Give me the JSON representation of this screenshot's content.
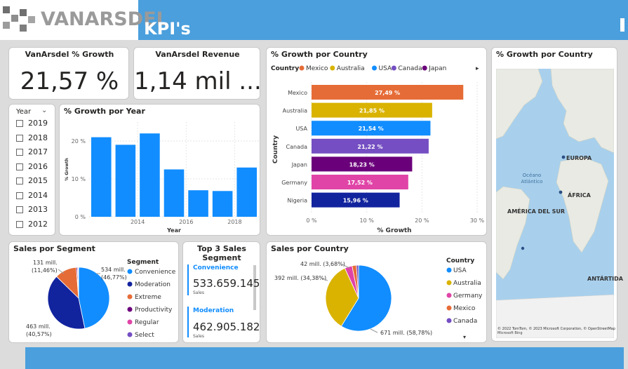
{
  "header": {
    "logo_text": "VANARSDEL",
    "page_title": "KPI's"
  },
  "kpis": {
    "growth": {
      "title": "VanArsdel % Growth",
      "value": "21,57 %"
    },
    "revenue": {
      "title": "VanArsdel Revenue",
      "value": "1,14 mil ..."
    }
  },
  "slicer": {
    "title": "Year",
    "years": [
      "2019",
      "2018",
      "2017",
      "2016",
      "2015",
      "2014",
      "2013",
      "2012"
    ]
  },
  "growth_by_year": {
    "title": "% Growth por Year"
  },
  "growth_by_country": {
    "title": "% Growth por Country",
    "legend_title": "Country"
  },
  "map": {
    "title": "% Growth por Country",
    "labels": {
      "europe": "EUROPA",
      "ocean": "Océano Atlántico",
      "africa": "ÁFRICA",
      "south_america": "AMÉRICA DEL SUR",
      "antarctica": "ANTÁRTIDA"
    },
    "attribution": "© 2022 TomTom, © 2023 Microsoft Corporation, © OpenStreetMap",
    "bing": "Microsoft Bing"
  },
  "sales_segment": {
    "title": "Sales por Segment",
    "legend_title": "Segment"
  },
  "top3": {
    "title": "Top 3 Sales Segment",
    "items": [
      {
        "label": "Convenience",
        "value": "533.659.145",
        "sub": "Sales"
      },
      {
        "label": "Moderation",
        "value": "462.905.182",
        "sub": "Sales"
      }
    ]
  },
  "sales_country": {
    "title": "Sales por Country",
    "legend_title": "Country"
  },
  "colors": {
    "header_blue": "#4a9fdc",
    "bar_blue": "#118dff",
    "navy": "#12239e",
    "orange": "#e66c37"
  },
  "chart_data": [
    {
      "type": "bar",
      "title": "% Growth por Year",
      "xlabel": "Year",
      "ylabel": "% Growth",
      "x": [
        2013,
        2014,
        2015,
        2016,
        2017,
        2018,
        2019
      ],
      "values": [
        21.0,
        19.0,
        22.0,
        12.5,
        7.0,
        6.8,
        13.0
      ],
      "ylim": [
        0,
        25
      ],
      "yticks": [
        "0 %",
        "10 %",
        "20 %"
      ],
      "xticks": [
        "2014",
        "2016",
        "2018"
      ]
    },
    {
      "type": "bar",
      "title": "% Growth por Country",
      "orientation": "horizontal",
      "xlabel": "% Growth",
      "ylabel": "Country",
      "categories": [
        "Mexico",
        "Australia",
        "USA",
        "Canada",
        "Japan",
        "Germany",
        "Nigeria"
      ],
      "values": [
        27.49,
        21.85,
        21.54,
        21.22,
        18.23,
        17.52,
        15.96
      ],
      "data_labels": [
        "27,49 %",
        "21,85 %",
        "21,54 %",
        "21,22 %",
        "18,23 %",
        "17,52 %",
        "15,96 %"
      ],
      "colors": [
        "#e66c37",
        "#d9b300",
        "#118dff",
        "#744ec2",
        "#6b007b",
        "#e044a7",
        "#12239e"
      ],
      "legend": [
        "Mexico",
        "Australia",
        "USA",
        "Canada",
        "Japan"
      ],
      "legend_colors": [
        "#e66c37",
        "#d9b300",
        "#118dff",
        "#744ec2",
        "#6b007b"
      ],
      "xlim": [
        0,
        30
      ],
      "xticks": [
        "0 %",
        "10 %",
        "20 %",
        "30 %"
      ]
    },
    {
      "type": "pie",
      "title": "Sales por Segment",
      "categories": [
        "Convenience",
        "Moderation",
        "Extreme",
        "Productivity",
        "Regular",
        "Select"
      ],
      "values": [
        46.77,
        40.57,
        11.46,
        0.6,
        0.4,
        0.2
      ],
      "colors": [
        "#118dff",
        "#12239e",
        "#e66c37",
        "#6b007b",
        "#e044a7",
        "#744ec2"
      ],
      "data_labels": [
        {
          "value": "534 mill.",
          "pct": "(46,77%)"
        },
        {
          "value": "463 mill.",
          "pct": "(40,57%)"
        },
        {
          "value": "131 mill.",
          "pct": "(11,46%)"
        }
      ]
    },
    {
      "type": "pie",
      "title": "Sales por Country",
      "categories": [
        "USA",
        "Australia",
        "Germany",
        "Mexico",
        "Canada"
      ],
      "values": [
        58.78,
        34.38,
        3.68,
        2.1,
        1.06
      ],
      "colors": [
        "#118dff",
        "#d9b300",
        "#e044a7",
        "#e66c37",
        "#744ec2"
      ],
      "data_labels": [
        "671 mill. (58,78%)",
        "392 mill. (34,38%)",
        "42 mill. (3,68%)"
      ]
    }
  ]
}
